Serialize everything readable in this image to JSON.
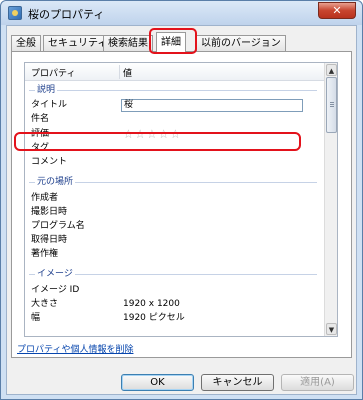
{
  "window": {
    "title": "桜のプロパティ",
    "close_glyph": "✕"
  },
  "tabs": [
    {
      "label": "全般"
    },
    {
      "label": "セキュリティ"
    },
    {
      "label": "検索結果"
    },
    {
      "label": "詳細",
      "active": true
    },
    {
      "label": "以前のバージョン"
    }
  ],
  "list": {
    "col_property": "プロパティ",
    "col_value": "値",
    "groups": {
      "description": "説明",
      "origin": "元の場所",
      "image": "イメージ"
    },
    "rows": {
      "title": {
        "name": "タイトル",
        "value": "桜"
      },
      "subject": {
        "name": "件名"
      },
      "rating": {
        "name": "評価",
        "stars": "☆☆☆☆☆",
        "rating_value": 0
      },
      "tags": {
        "name": "タグ"
      },
      "comments": {
        "name": "コメント"
      },
      "authors": {
        "name": "作成者"
      },
      "date_taken": {
        "name": "撮影日時"
      },
      "program": {
        "name": "プログラム名"
      },
      "date_acquired": {
        "name": "取得日時"
      },
      "copyright": {
        "name": "著作権"
      },
      "image_id": {
        "name": "イメージ ID"
      },
      "dimensions": {
        "name": "大きさ",
        "value": "1920 x 1200"
      },
      "width": {
        "name": "幅",
        "value": "1920 ピクセル"
      }
    }
  },
  "remove_link": "プロパティや個人情報を削除",
  "buttons": {
    "ok": "OK",
    "cancel": "キャンセル",
    "apply": "適用(A)"
  },
  "colors": {
    "highlight": "#e3121b",
    "group_text": "#1e3f8c",
    "link": "#0645ad"
  }
}
